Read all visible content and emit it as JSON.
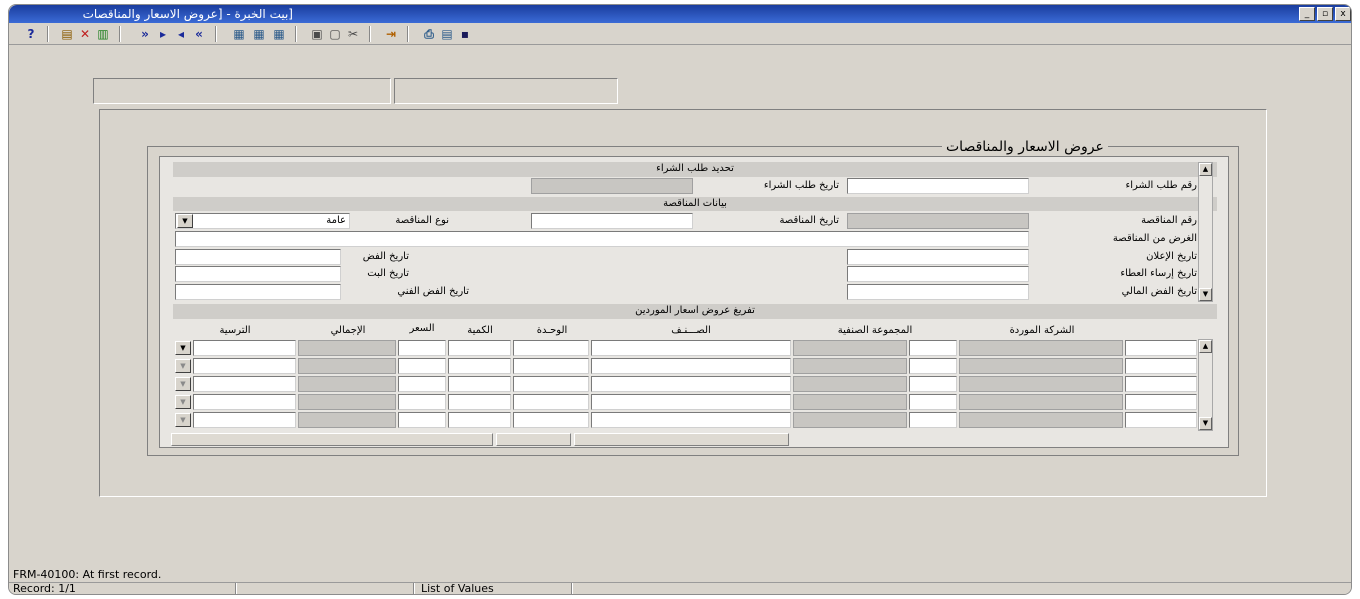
{
  "window": {
    "title": "[بيت الخبرة - [عروض الاسعار والمناقصات",
    "controls": [
      "_",
      "▫",
      "x"
    ]
  },
  "toolbar": {
    "help": "?",
    "icons": [
      "insert-record-icon",
      "delete-record-icon",
      "clear-record-icon",
      "first-record-icon",
      "next-record-icon",
      "previous-record-icon",
      "last-record-icon",
      "query-icon",
      "execute-query-icon",
      "cancel-query-icon",
      "copy-icon",
      "paste-icon",
      "cut-icon",
      "exit-icon",
      "print-icon",
      "preview-icon",
      "save-icon"
    ]
  },
  "form": {
    "title": "عروض الاسعار والمناقصات",
    "purchase_section": "تحديد طلب الشراء",
    "purchase_no_label": "رقم طلب الشراء",
    "purchase_date_label": "تاريخ طلب الشراء",
    "tender_section": "بيانات المناقصة",
    "tender_no_label": "رقم المناقصة",
    "tender_date_label": "تاريخ المناقصة",
    "tender_type_label": "نوع المناقصة",
    "tender_type_value": "عامة",
    "tender_purpose_label": "الغرض من المناقصة",
    "announce_date_label": "تاريخ الإعلان",
    "open_date_label": "تاريخ الفض",
    "award_date_label": "تاريخ إرساء العطاء",
    "decision_date_label": "تاريخ البت",
    "financial_open_label": "تاريخ الفض المالي",
    "technical_open_label": "تاريخ الفض الفني"
  },
  "grid": {
    "section": "تفريغ عروض اسعار الموردين",
    "headers": {
      "company": "الشركة الموردة",
      "category": "المجموعة الصنفية",
      "item": "الصـــنـف",
      "unit": "الوحـدة",
      "qty": "الكمية",
      "price": "السعر",
      "total": "الإجمالي",
      "award": "الترسية"
    },
    "rows": 5
  },
  "status": {
    "message": "FRM-40100: At first record.",
    "record": "Record: 1/1",
    "lov": "List of Values"
  }
}
